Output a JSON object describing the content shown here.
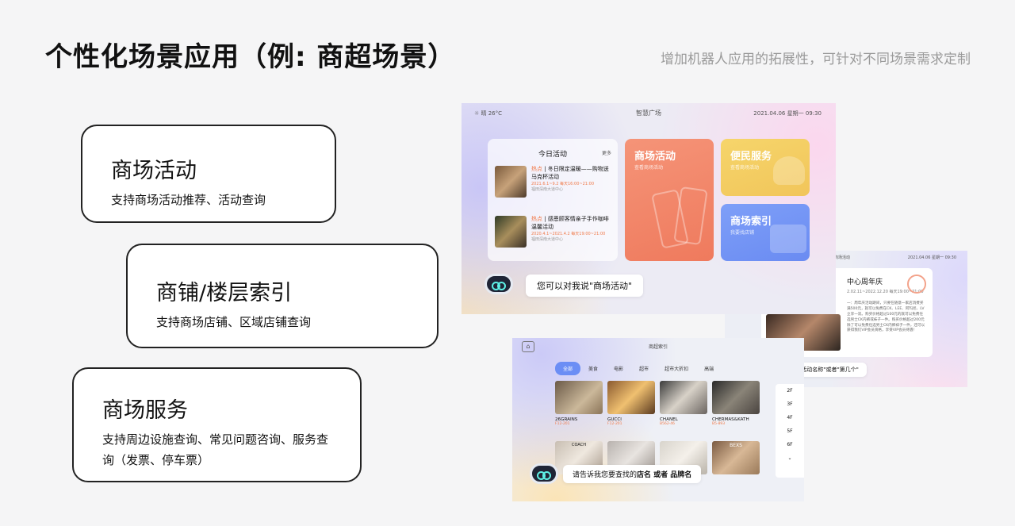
{
  "header": {
    "title": "个性化场景应用（例: 商超场景）",
    "subtitle": "增加机器人应用的拓展性，可针对不同场景需求定制"
  },
  "features": [
    {
      "title": "商场活动",
      "desc": "支持商场活动推荐、活动查询"
    },
    {
      "title": "商铺/楼层索引",
      "desc": "支持商场店铺、区域店铺查询"
    },
    {
      "title": "商场服务",
      "desc": "支持周边设施查询、常见问题咨询、服务查询（发票、停车票）"
    }
  ],
  "screen1": {
    "weather": "☼ 晴  26°C",
    "mall": "智慧广场",
    "datetime": "2021.04.06  星期一  09:30",
    "activity_title": "今日活动",
    "more": "更多",
    "items": [
      {
        "tag": "热点",
        "name": "冬日限定温暖——购物送马克杯活动",
        "date": "2021.6.1~9.2  每天16:00~21:00",
        "place": "福田深南大道中心"
      },
      {
        "tag": "热点",
        "name": "感恩顾客情亲子手作咖啡温馨活动",
        "date": "2020.4.1~2021.4.2  每天19:00~21:00",
        "place": "福田深南大道中心"
      }
    ],
    "tile_activity": {
      "title": "商场活动",
      "sub": "查看商场活动"
    },
    "tile_service": {
      "title": "便民服务",
      "sub": "查看商场活动"
    },
    "tile_index": {
      "title": "商场索引",
      "sub": "我要找店铺"
    },
    "bubble": "您可以对我说\"商场活动\""
  },
  "screen3": {
    "header_left": "商场活动",
    "header_right": "2021.04.06  星期一  09:30",
    "title": "中心周年庆",
    "date": "2.02.11~2022.12.20  每天19:00~21:00",
    "body": "一：周年庆活动期间，只要在随意一家店消费买满500元，就可以免费在CK、LEE、阿玛尼、LV立享一双。购买价格超过100元的就可以免费任选男士CK内裤或袜子一件。购买价格超过200元除了可以免费任选男士CK内裤袜子一件，还可以获得我们VIP会员资格，享受VIP会员待遇！",
    "bubble": "对我说\"活动名称\"或者\"第几个\""
  },
  "screen2": {
    "home": "⌂",
    "title": "商超索引",
    "tabs": [
      "全部",
      "美食",
      "电影",
      "超市",
      "超市大折扣",
      "高端"
    ],
    "shops": [
      {
        "name": "26GRAINS",
        "floor": "F12-201"
      },
      {
        "name": "GUCCI",
        "floor": "F12-201"
      },
      {
        "name": "CHANEL",
        "floor": "B562-46"
      },
      {
        "name": "CHERMAS&KATH",
        "floor": "B5-893"
      }
    ],
    "shops_row2": [
      "COACH",
      "",
      "",
      "BEXS"
    ],
    "floors": [
      "2F",
      "3F",
      "4F",
      "5F",
      "6F",
      "⌄"
    ],
    "bubble_pre": "请告诉我您要查找的",
    "bubble_bold": "店名 或者 品牌名"
  }
}
